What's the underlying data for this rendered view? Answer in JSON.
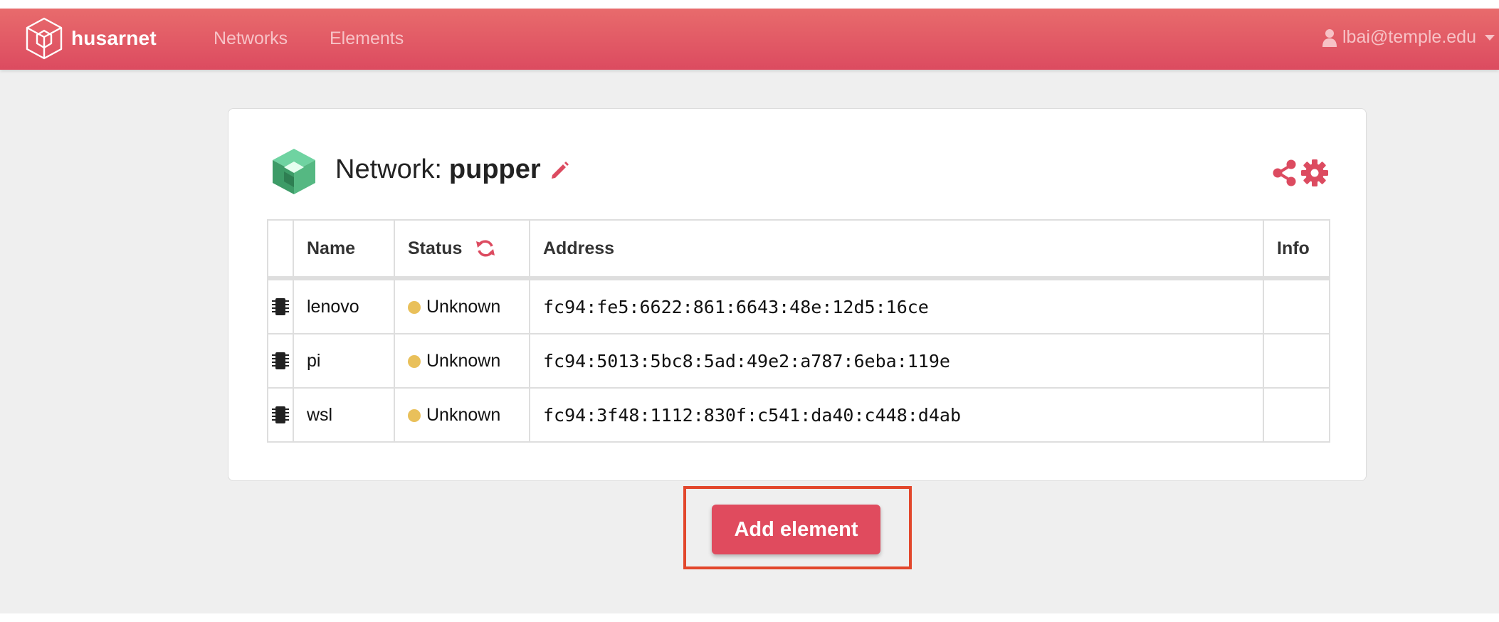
{
  "navbar": {
    "brand": "husarnet",
    "links": [
      "Networks",
      "Elements"
    ],
    "user_email": "lbai@temple.edu"
  },
  "network": {
    "title_prefix": "Network:",
    "name": "pupper"
  },
  "table": {
    "headers": [
      "",
      "Name",
      "Status",
      "Address",
      "Info"
    ],
    "rows": [
      {
        "name": "lenovo",
        "status": "Unknown",
        "address": "fc94:fe5:6622:861:6643:48e:12d5:16ce",
        "info": ""
      },
      {
        "name": "pi",
        "status": "Unknown",
        "address": "fc94:5013:5bc8:5ad:49e2:a787:6eba:119e",
        "info": ""
      },
      {
        "name": "wsl",
        "status": "Unknown",
        "address": "fc94:3f48:1112:830f:c541:da40:c448:d4ab",
        "info": ""
      }
    ]
  },
  "actions": {
    "add_element": "Add element"
  },
  "colors": {
    "brand": "#dc4b60",
    "accent": "#e04b5e",
    "status_unknown": "#e9c05a",
    "highlight": "#e2472c"
  },
  "icons": [
    "husarnet-logo-icon",
    "user-icon",
    "network-logo-icon",
    "pencil-icon",
    "share-icon",
    "gear-icon",
    "refresh-icon",
    "chip-icon"
  ]
}
